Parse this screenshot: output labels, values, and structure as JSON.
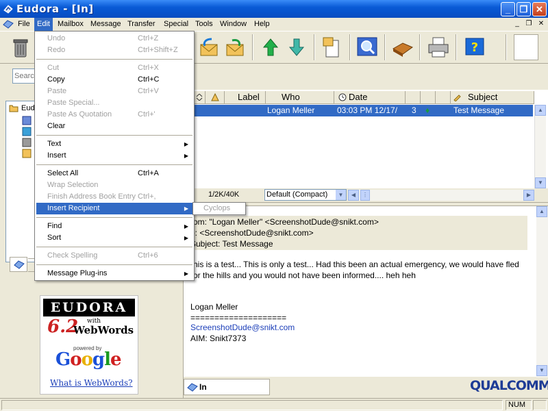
{
  "window": {
    "title": "Eudora - [In]"
  },
  "menubar": {
    "items": [
      "File",
      "Edit",
      "Mailbox",
      "Message",
      "Transfer",
      "Special",
      "Tools",
      "Window",
      "Help"
    ],
    "active": "Edit"
  },
  "search": {
    "placeholder": "Searc"
  },
  "tree": {
    "root_label": "Eud"
  },
  "message_list": {
    "columns": [
      "Label",
      "Who",
      "Date",
      "Subject"
    ],
    "rows": [
      {
        "who": "Logan Meller",
        "date": "03:03 PM 12/17/",
        "size": "3",
        "subject": "Test Message",
        "selected": true
      }
    ],
    "count": "1/2K/40K",
    "view": "Default (Compact)"
  },
  "preview": {
    "from": "rom: \"Logan Meller\" <ScreenshotDude@snikt.com>",
    "to": "o: <ScreenshotDude@snikt.com>",
    "subject": "Subject: Test Message",
    "body_line1": "his is a test... This is only a test... Had this been an actual emergency, we would have fled",
    "body_line2": "or the hills and you would not have been informed.... heh heh",
    "sig_name": "Logan Meller",
    "sig_rule": "====================",
    "sig_email": "ScreenshotDude@snikt.com",
    "sig_aim": "AIM: Snikt7373"
  },
  "ad": {
    "brand": "EUDORA",
    "version": "6.2",
    "with": "with",
    "product": "WebWords",
    "powered_by": "powered by",
    "google_letters": [
      "G",
      "o",
      "o",
      "g",
      "l",
      "e"
    ],
    "link": "What is WebWords?"
  },
  "mailbox_tab": {
    "label": "In"
  },
  "footer_brand": "QUALCOMM",
  "statusbar": {
    "num": "NUM"
  },
  "edit_menu": {
    "items": [
      {
        "label": "Undo",
        "shortcut": "Ctrl+Z",
        "disabled": true
      },
      {
        "label": "Redo",
        "shortcut": "Ctrl+Shift+Z",
        "disabled": true
      },
      {
        "label": "Cut",
        "shortcut": "Ctrl+X",
        "disabled": true
      },
      {
        "label": "Copy",
        "shortcut": "Ctrl+C",
        "disabled": false
      },
      {
        "label": "Paste",
        "shortcut": "Ctrl+V",
        "disabled": true
      },
      {
        "label": "Paste Special...",
        "shortcut": "",
        "disabled": true
      },
      {
        "label": "Paste As Quotation",
        "shortcut": "Ctrl+'",
        "disabled": true
      },
      {
        "label": "Clear",
        "shortcut": "",
        "disabled": false
      },
      {
        "label": "Text",
        "shortcut": "",
        "disabled": false,
        "submenu": true
      },
      {
        "label": "Insert",
        "shortcut": "",
        "disabled": false,
        "submenu": true
      },
      {
        "label": "Select All",
        "shortcut": "Ctrl+A",
        "disabled": false
      },
      {
        "label": "Wrap Selection",
        "shortcut": "",
        "disabled": true
      },
      {
        "label": "Finish Address Book Entry",
        "shortcut": "Ctrl+,",
        "disabled": true
      },
      {
        "label": "Insert Recipient",
        "shortcut": "",
        "disabled": false,
        "submenu": true,
        "highlighted": true
      },
      {
        "label": "Find",
        "shortcut": "",
        "disabled": false,
        "submenu": true
      },
      {
        "label": "Sort",
        "shortcut": "",
        "disabled": false,
        "submenu": true
      },
      {
        "label": "Check Spelling",
        "shortcut": "Ctrl+6",
        "disabled": true
      },
      {
        "label": "Message Plug-ins",
        "shortcut": "",
        "disabled": false,
        "submenu": true
      }
    ]
  },
  "insert_recipient_submenu": {
    "items": [
      "Cyclops"
    ]
  },
  "colors": {
    "titlebar": "#0a5bd6",
    "selection": "#316ac5",
    "chrome": "#ece9d8"
  }
}
